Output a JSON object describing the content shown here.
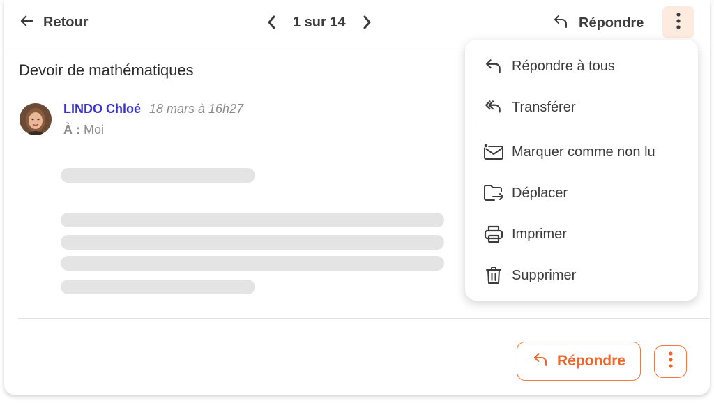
{
  "topbar": {
    "back_label": "Retour",
    "pager": "1 sur 14",
    "reply_label": "Répondre"
  },
  "message": {
    "subject": "Devoir de mathématiques",
    "sender": "LINDO Chloé",
    "date": "18 mars à 16h27",
    "to_label": "À :",
    "to_value": "Moi"
  },
  "menu": {
    "items": [
      {
        "label": "Répondre à tous",
        "icon": "reply-all-icon"
      },
      {
        "label": "Transférer",
        "icon": "forward-icon"
      },
      {
        "label": "Marquer comme non lu",
        "icon": "mark-unread-icon"
      },
      {
        "label": "Déplacer",
        "icon": "move-folder-icon"
      },
      {
        "label": "Imprimer",
        "icon": "print-icon"
      },
      {
        "label": "Supprimer",
        "icon": "trash-icon"
      }
    ]
  },
  "footer": {
    "reply_label": "Répondre"
  },
  "colors": {
    "accent": "#f0652a",
    "sender": "#3b35c9",
    "more_bg": "#fdebdf"
  }
}
